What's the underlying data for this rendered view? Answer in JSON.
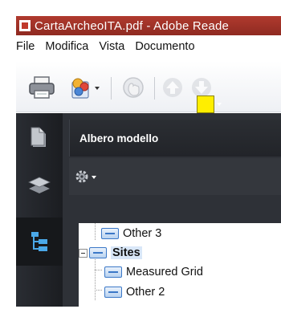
{
  "window": {
    "title": "CartaArcheoITA.pdf - Adobe Reade"
  },
  "menubar": {
    "items": [
      "File",
      "Modifica",
      "Vista",
      "Documento"
    ]
  },
  "toolbar": {
    "icons": [
      "printer-icon",
      "share-icon",
      "hand-icon",
      "previous-page-icon",
      "next-page-icon"
    ]
  },
  "leftnav": {
    "icons": [
      "pages-icon",
      "layers-icon",
      "model-tree-icon"
    ],
    "active": "model-tree-icon"
  },
  "panel": {
    "title": "Albero modello",
    "swatch_color": "#ffee00",
    "tree": [
      {
        "label": "Other 3",
        "level": 1
      },
      {
        "label": "Sites",
        "level": 0,
        "expanded": true,
        "selected": true
      },
      {
        "label": "Measured Grid",
        "level": 1
      },
      {
        "label": "Other 2",
        "level": 1
      }
    ]
  }
}
